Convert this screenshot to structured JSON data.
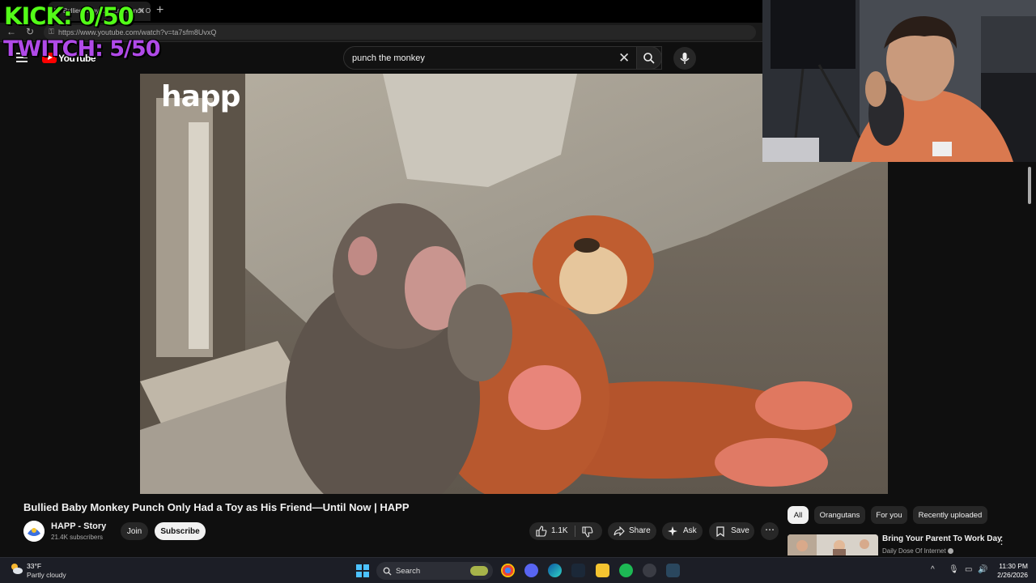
{
  "overlay": {
    "kick": "KICK: 0/50",
    "twitch": "TWITCH: 5/50"
  },
  "browser": {
    "tab_title": "(1) Bullied Baby Monkey Punch O",
    "tab_close": "✕",
    "new_tab": "+",
    "url": "https://www.youtube.com/watch?v=ta7sfm8UvxQ"
  },
  "youtube": {
    "logo_text": "YouTube",
    "search_query": "punch the monkey"
  },
  "video": {
    "watermark": "happ",
    "title": "Bullied Baby Monkey Punch Only Had a Toy as His Friend—Until Now | HAPP",
    "channel_name": "HAPP - Story",
    "subscribers": "21.4K subscribers",
    "join_label": "Join",
    "subscribe_label": "Subscribe",
    "like_count": "1.1K",
    "share_label": "Share",
    "ask_label": "Ask",
    "save_label": "Save"
  },
  "sidebar": {
    "chips": [
      "All",
      "Orangutans",
      "For you",
      "Recently uploaded"
    ],
    "active_chip": "All",
    "recommendation": {
      "title": "Bring Your Parent To Work Day",
      "channel": "Daily Dose Of Internet"
    }
  },
  "taskbar": {
    "weather_temp": "33°F",
    "weather_desc": "Partly cloudy",
    "search_label": "Search",
    "time": "11:30 PM",
    "date": "2/26/2026"
  },
  "colors": {
    "kick_green": "#53fc18",
    "twitch_purple": "#b04ae8",
    "youtube_red": "#ff0000",
    "background": "#0f0f0f"
  }
}
